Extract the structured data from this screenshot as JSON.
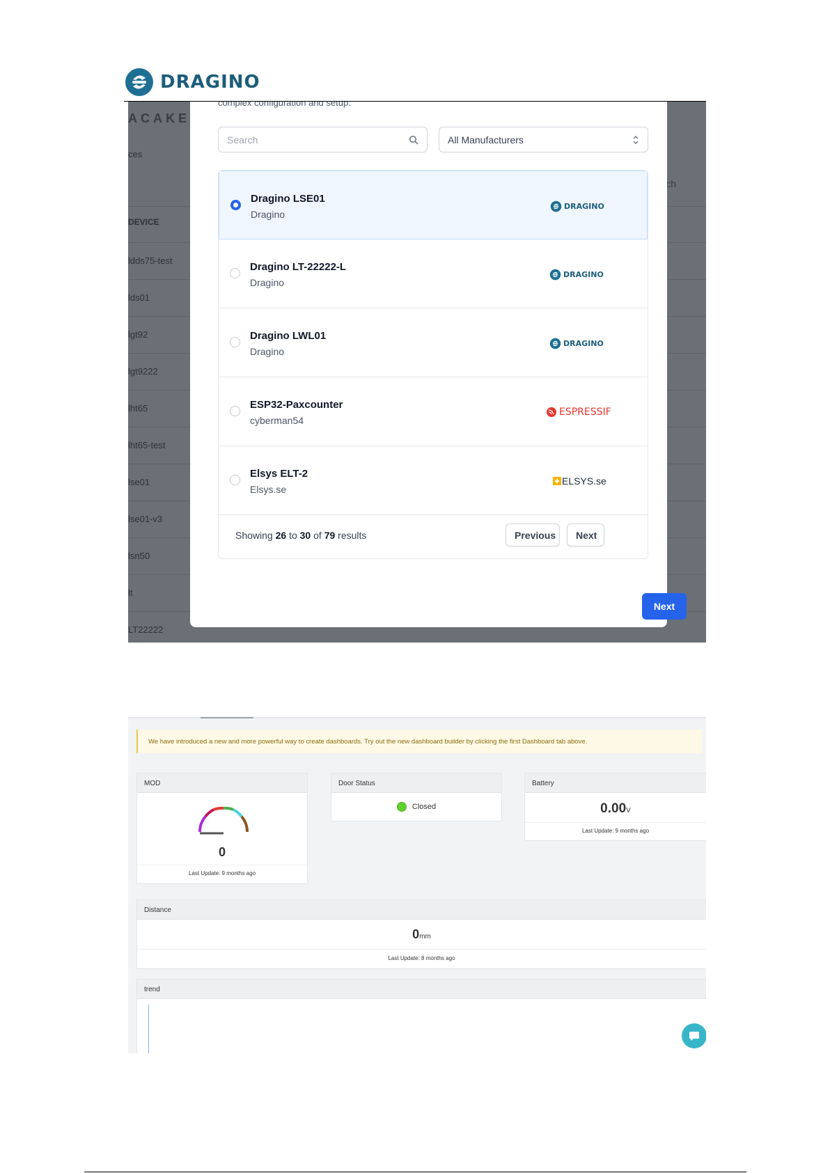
{
  "doc": {
    "brand": "DRAGINO"
  },
  "screen1": {
    "background": {
      "brand": "ACAKE",
      "breadcrumb": "ces",
      "search": "earch",
      "column_header": "DEVICE",
      "devices": [
        "ldds75-test",
        "lds01",
        "lgt92",
        "lgt9222",
        "lht65",
        "lht65-test",
        "lse01",
        "lse01-v3",
        "lsn50",
        "lt",
        "LT22222"
      ]
    },
    "modal": {
      "intro_text": "complex configuration and setup.",
      "search_placeholder": "Search",
      "manufacturer_select": "All Manufacturers",
      "items": [
        {
          "name": "Dragino LSE01",
          "maker": "Dragino",
          "logo": "DRAGINO",
          "selected": true
        },
        {
          "name": "Dragino LT-22222-L",
          "maker": "Dragino",
          "logo": "DRAGINO",
          "selected": false
        },
        {
          "name": "Dragino LWL01",
          "maker": "Dragino",
          "logo": "DRAGINO",
          "selected": false
        },
        {
          "name": "ESP32-Paxcounter",
          "maker": "cyberman54",
          "logo": "ESPRESSIF",
          "selected": false
        },
        {
          "name": "Elsys ELT-2",
          "maker": "Elsys.se",
          "logo": "ELSYS.se",
          "selected": false
        }
      ],
      "pagination": {
        "showing": "Showing",
        "from": "26",
        "to_word": "to",
        "to": "30",
        "of_word": "of",
        "total": "79",
        "results_word": "results",
        "previous": "Previous",
        "next": "Next"
      },
      "next_button": "Next"
    }
  },
  "screen2": {
    "notice": "We have introduced a new and more powerful way to create dashboards. Try out the new dashboard builder by clicking the first Dashboard tab above.",
    "widgets": {
      "mod": {
        "title": "MOD",
        "value": "0",
        "gauge_fraction": 0,
        "last_update": "Last Update: 9 months ago"
      },
      "door": {
        "title": "Door Status",
        "status": "Closed",
        "status_color": "#5fcf2d"
      },
      "battery": {
        "title": "Battery",
        "value": "0.00",
        "unit": "V",
        "last_update": "Last Update: 9 months ago"
      },
      "distance": {
        "title": "Distance",
        "value": "0",
        "unit": "mm",
        "last_update": "Last Update: 8 months ago"
      },
      "trend": {
        "title": "trend"
      }
    },
    "chat_icon": "chat-bubble-icon"
  }
}
